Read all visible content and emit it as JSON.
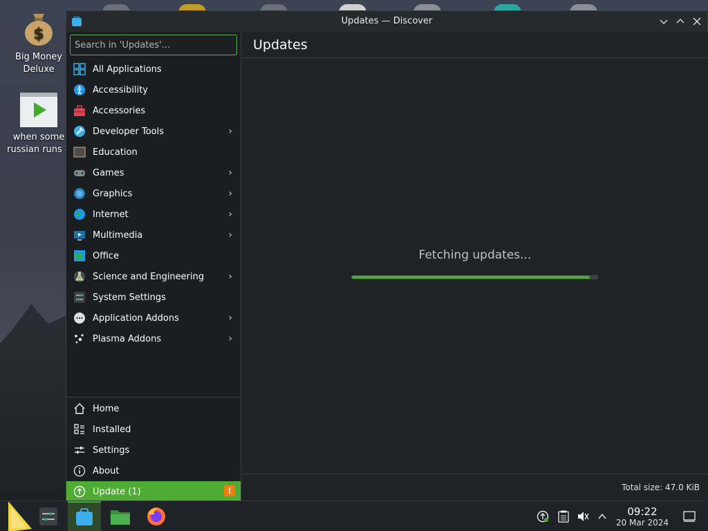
{
  "desktop": {
    "icons": [
      {
        "label_line1": "Big Money",
        "label_line2": "Deluxe"
      },
      {
        "label_line1": "when some",
        "label_line2": "russian runs a"
      }
    ]
  },
  "window": {
    "title": "Updates — Discover",
    "buttons": {
      "minimize": "⌄",
      "maximize": "⌃",
      "close": "✕"
    }
  },
  "sidebar": {
    "search_placeholder": "Search in 'Updates'...",
    "categories": [
      {
        "label": "All Applications",
        "icon": "grid-icon",
        "has_submenu": false
      },
      {
        "label": "Accessibility",
        "icon": "accessibility-icon",
        "has_submenu": false
      },
      {
        "label": "Accessories",
        "icon": "toolbox-icon",
        "has_submenu": false
      },
      {
        "label": "Developer Tools",
        "icon": "hammer-icon",
        "has_submenu": true
      },
      {
        "label": "Education",
        "icon": "chalkboard-icon",
        "has_submenu": false
      },
      {
        "label": "Games",
        "icon": "gamepad-icon",
        "has_submenu": true
      },
      {
        "label": "Graphics",
        "icon": "graphics-icon",
        "has_submenu": true
      },
      {
        "label": "Internet",
        "icon": "globe-icon",
        "has_submenu": true
      },
      {
        "label": "Multimedia",
        "icon": "multimedia-icon",
        "has_submenu": true
      },
      {
        "label": "Office",
        "icon": "office-icon",
        "has_submenu": false
      },
      {
        "label": "Science and Engineering",
        "icon": "flask-icon",
        "has_submenu": true
      },
      {
        "label": "System Settings",
        "icon": "system-settings-icon",
        "has_submenu": false
      },
      {
        "label": "Application Addons",
        "icon": "addons-icon",
        "has_submenu": true
      },
      {
        "label": "Plasma Addons",
        "icon": "plasma-icon",
        "has_submenu": true
      }
    ],
    "nav": [
      {
        "label": "Home",
        "icon": "home-icon"
      },
      {
        "label": "Installed",
        "icon": "installed-icon"
      },
      {
        "label": "Settings",
        "icon": "settings-icon"
      },
      {
        "label": "About",
        "icon": "info-icon"
      },
      {
        "label": "Update (1)",
        "icon": "update-icon",
        "badge": "!"
      }
    ]
  },
  "main": {
    "page_title": "Updates",
    "status_text": "Fetching updates...",
    "progress": 0.97,
    "total_size": "Total size: 47.0 KiB"
  },
  "taskbar": {
    "clock_time": "09:22",
    "clock_date": "20 Mar 2024"
  },
  "colors": {
    "accent": "#4eac35",
    "warning": "#f47c0e",
    "window_bg": "#202326",
    "sidebar_bg": "#1b1e20"
  }
}
